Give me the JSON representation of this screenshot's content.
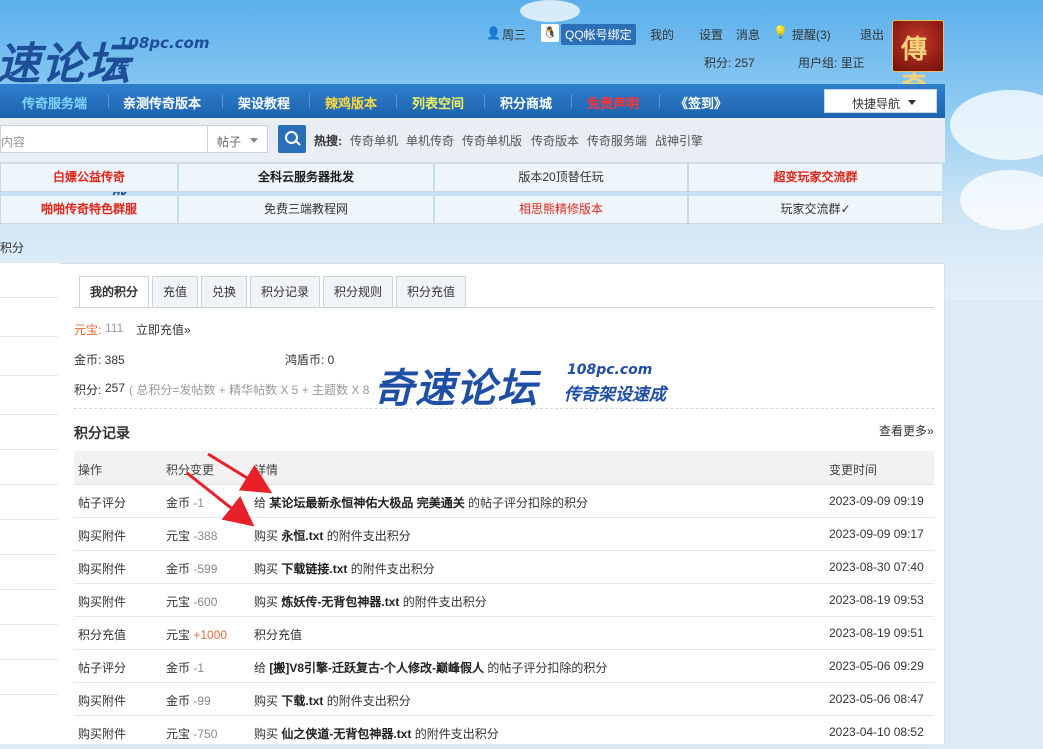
{
  "logo": {
    "main": "速论坛",
    "domain": "108pc.com",
    "slogan": "传奇架设速成"
  },
  "user_bar": {
    "weekday": "周三",
    "qq_bind": "QQ帐号绑定",
    "mine": "我的",
    "settings": "设置",
    "messages": "消息",
    "reminders": "提醒(3)",
    "logout": "退出",
    "points": "积分: 257",
    "usergroup": "用户组: 里正",
    "avatar_text": "傳奇"
  },
  "nav": {
    "items": [
      {
        "label": "传奇服务端",
        "color": "#7fd3ff"
      },
      {
        "label": "亲测传奇版本",
        "color": "#ffffff"
      },
      {
        "label": "架设教程",
        "color": "#ffffff"
      },
      {
        "label": "辣鸡版本",
        "color": "#ffd93d"
      },
      {
        "label": "列表空间",
        "color": "#f2f25a"
      },
      {
        "label": "积分商城",
        "color": "#ffffff"
      },
      {
        "label": "免责声明",
        "color": "#ff3333"
      },
      {
        "label": "《签到》",
        "color": "#ffffff"
      }
    ],
    "quick_nav": "快捷导航"
  },
  "search": {
    "placeholder": "内容",
    "type": "帖子",
    "hot_label": "热搜:",
    "hot": [
      "传奇单机",
      "单机传奇",
      "传奇单机版",
      "传奇版本",
      "传奇服务端",
      "战神引擎"
    ]
  },
  "ads": [
    {
      "label": "白嫖公益传奇",
      "style": "red"
    },
    {
      "label": "全科云服务器批发",
      "style": "bold"
    },
    {
      "label": "版本20顶替任玩",
      "style": "normal"
    },
    {
      "label": "超变玩家交流群",
      "style": "red"
    },
    {
      "label": "啪啪传奇特色群服",
      "style": "red"
    },
    {
      "label": "免费三端教程网",
      "style": "normal"
    },
    {
      "label": "相思熊精修版本",
      "style": "red"
    },
    {
      "label": "玩家交流群✓",
      "style": "normal"
    }
  ],
  "breadcrumb": "积分",
  "tabs": [
    "我的积分",
    "充值",
    "兑换",
    "积分记录",
    "积分规则",
    "积分充值"
  ],
  "summary": {
    "yuanbao_label": "元宝:",
    "yuanbao_value": "111",
    "recharge_link": "立即充值»",
    "gold": "金币: 385",
    "shield": "鸿盾币: 0",
    "points_label": "积分:",
    "points_value": "257",
    "formula": "( 总积分=发帖数 + 精华帖数 X 5 + 主题数 X 8"
  },
  "records": {
    "title": "积分记录",
    "more": "查看更多»",
    "headers": [
      "操作",
      "积分变更",
      "详情",
      "变更时间"
    ],
    "rows": [
      {
        "op": "帖子评分",
        "currency": "金币",
        "amount": "-1",
        "positive": false,
        "pre": "给",
        "bold": "某论坛最新永恒神佑大极品 完美通关",
        "post": "的帖子评分扣除的积分",
        "time": "2023-09-09 09:19"
      },
      {
        "op": "购买附件",
        "currency": "元宝",
        "amount": "-388",
        "positive": false,
        "pre": "购买",
        "bold": "永恒.txt",
        "post": "的附件支出积分",
        "time": "2023-09-09 09:17"
      },
      {
        "op": "购买附件",
        "currency": "金币",
        "amount": "-599",
        "positive": false,
        "pre": "购买",
        "bold": "下载链接.txt",
        "post": "的附件支出积分",
        "time": "2023-08-30 07:40"
      },
      {
        "op": "购买附件",
        "currency": "元宝",
        "amount": "-600",
        "positive": false,
        "pre": "购买",
        "bold": "炼妖传-无背包神器.txt",
        "post": "的附件支出积分",
        "time": "2023-08-19 09:53"
      },
      {
        "op": "积分充值",
        "currency": "元宝",
        "amount": "+1000",
        "positive": true,
        "pre": "积分充值",
        "bold": "",
        "post": "",
        "time": "2023-08-19 09:51"
      },
      {
        "op": "帖子评分",
        "currency": "金币",
        "amount": "-1",
        "positive": false,
        "pre": "给",
        "bold": "[搬]V8引擎-迁跃复古-个人修改-巅峰假人",
        "post": "的帖子评分扣除的积分",
        "time": "2023-05-06 09:29"
      },
      {
        "op": "购买附件",
        "currency": "金币",
        "amount": "-99",
        "positive": false,
        "pre": "购买",
        "bold": "下载.txt",
        "post": "的附件支出积分",
        "time": "2023-05-06 08:47"
      },
      {
        "op": "购买附件",
        "currency": "元宝",
        "amount": "-750",
        "positive": false,
        "pre": "购买",
        "bold": "仙之侠道-无背包神器.txt",
        "post": "的附件支出积分",
        "time": "2023-04-10 08:52"
      }
    ]
  },
  "watermark": {
    "main": "奇速论坛",
    "domain": "108pc.com",
    "slogan": "传奇架设速成"
  },
  "colors": {
    "nav_bg": "#1e63ae",
    "accent_blue": "#2a6fb8",
    "ad_red": "#e0261b",
    "arrow_red": "#e8202a"
  }
}
